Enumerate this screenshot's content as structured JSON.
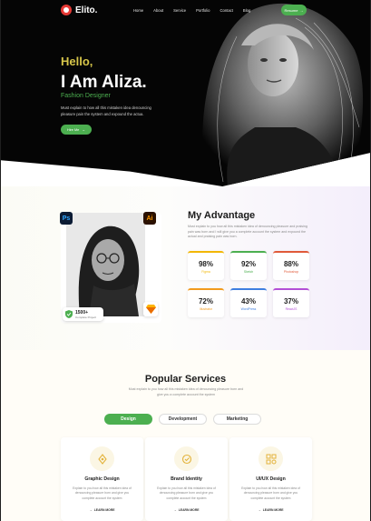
{
  "nav": {
    "brand": "Elito.",
    "links": [
      "Home",
      "About",
      "Service",
      "Portfolio",
      "Contact",
      "Blog"
    ],
    "resume_label": "Resume"
  },
  "hero": {
    "greeting": "Hello,",
    "name": "I Am Aliza.",
    "role": "Fashion Designer",
    "intro": "Must explain to how all this mistaken idea denouncing pleasure pain the system and expound the actua.",
    "hire_label": "Hire Me"
  },
  "advantage": {
    "title": "My Advantage",
    "text": "Must explain to you how all this mistaken idea of denouncing pleasure and praising pain was born and I will give you a complete account the system and expound the actual and praising pain was born.",
    "projects_count": "1500+",
    "projects_label": "Complete Project",
    "skills_badges": [
      "Ps",
      "Ai"
    ],
    "stats": [
      {
        "value": "98%",
        "label": "Figma",
        "color": "#f2b705"
      },
      {
        "value": "92%",
        "label": "Sketch",
        "color": "#4caf50"
      },
      {
        "value": "88%",
        "label": "Photoshop",
        "color": "#e05a3a"
      },
      {
        "value": "72%",
        "label": "Illustrator",
        "color": "#f29b1d"
      },
      {
        "value": "43%",
        "label": "WordPress",
        "color": "#3f7fe0"
      },
      {
        "value": "37%",
        "label": "ReactJS",
        "color": "#b34fd6"
      }
    ]
  },
  "services": {
    "title": "Popular Services",
    "text": "Must explain to you how all this mistaken idea of denouncing pleasure born and give you a complete account the system",
    "tabs": [
      "Design",
      "Development",
      "Marketing"
    ],
    "cards": [
      {
        "title": "Graphic Design",
        "text": "Explain to you how all this mistaken idea of denouncing pleasure born and give you complete account the system",
        "more": "LEARN MORE",
        "icon": "pen-tool-icon"
      },
      {
        "title": "Brand Identity",
        "text": "Explain to you how all this mistaken idea of denouncing pleasure born and give you complete account the system",
        "more": "LEARN MORE",
        "icon": "brand-icon"
      },
      {
        "title": "UI/UX Design",
        "text": "Explain to you how all this mistaken idea of denouncing pleasure born and give you complete account the system",
        "more": "LEARN MORE",
        "icon": "layout-icon"
      }
    ]
  },
  "colors": {
    "accent": "#4caf50",
    "highlight": "#d7c64a",
    "hero_bg": "#050505"
  }
}
